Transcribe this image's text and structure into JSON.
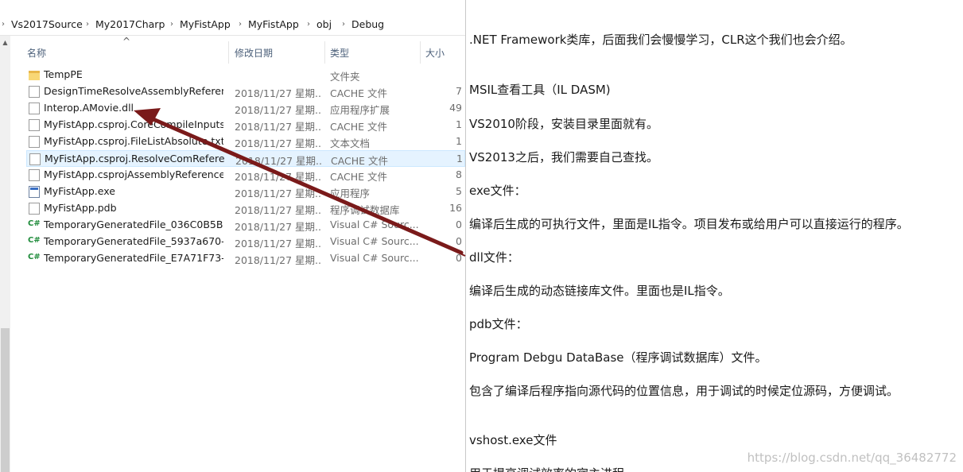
{
  "explorer": {
    "breadcrumb": [
      "Vs2017Source",
      "My2017Charp",
      "MyFistApp",
      "MyFistApp",
      "obj",
      "Debug"
    ],
    "columns": {
      "name": "名称",
      "date": "修改日期",
      "type": "类型",
      "size": "大小"
    },
    "files": [
      {
        "name": "TempPE",
        "date": "",
        "type": "文件夹",
        "size": "",
        "icon": "folder-icon",
        "selected": false
      },
      {
        "name": "DesignTimeResolveAssemblyReferen...",
        "date": "2018/11/27 星期...",
        "type": "CACHE 文件",
        "size": "7",
        "icon": "file-icon",
        "selected": false
      },
      {
        "name": "Interop.AMovie.dll",
        "date": "2018/11/27 星期...",
        "type": "应用程序扩展",
        "size": "49",
        "icon": "dll-file-icon",
        "selected": false
      },
      {
        "name": "MyFistApp.csproj.CoreCompileInputs...",
        "date": "2018/11/27 星期...",
        "type": "CACHE 文件",
        "size": "1",
        "icon": "file-icon",
        "selected": false
      },
      {
        "name": "MyFistApp.csproj.FileListAbsolute.txt",
        "date": "2018/11/27 星期...",
        "type": "文本文档",
        "size": "1",
        "icon": "text-file-icon",
        "selected": false
      },
      {
        "name": "MyFistApp.csproj.ResolveComRefere...",
        "date": "2018/11/27 星期...",
        "type": "CACHE 文件",
        "size": "1",
        "icon": "file-icon",
        "selected": true
      },
      {
        "name": "MyFistApp.csprojAssemblyReference....",
        "date": "2018/11/27 星期...",
        "type": "CACHE 文件",
        "size": "8",
        "icon": "file-icon",
        "selected": false
      },
      {
        "name": "MyFistApp.exe",
        "date": "2018/11/27 星期...",
        "type": "应用程序",
        "size": "5",
        "icon": "exe-file-icon",
        "selected": false
      },
      {
        "name": "MyFistApp.pdb",
        "date": "2018/11/27 星期...",
        "type": "程序调试数据库",
        "size": "16",
        "icon": "pdb-file-icon",
        "selected": false
      },
      {
        "name": "TemporaryGeneratedFile_036C0B5B-...",
        "date": "2018/11/27 星期...",
        "type": "Visual C# Sourc...",
        "size": "0",
        "icon": "csharp-file-icon",
        "selected": false
      },
      {
        "name": "TemporaryGeneratedFile_5937a670-0...",
        "date": "2018/11/27 星期...",
        "type": "Visual C# Sourc...",
        "size": "0",
        "icon": "csharp-file-icon",
        "selected": false
      },
      {
        "name": "TemporaryGeneratedFile_E7A71F73-0...",
        "date": "2018/11/27 星期...",
        "type": "Visual C# Sourc...",
        "size": "0",
        "icon": "csharp-file-icon",
        "selected": false
      }
    ],
    "cs_glyph": "C#"
  },
  "article": {
    "paragraphs": [
      ".NET Framework类库，后面我们会慢慢学习，CLR这个我们也会介绍。",
      "MSIL查看工具（IL DASM)",
      "VS2010阶段，安装目录里面就有。",
      "VS2013之后，我们需要自己查找。",
      "exe文件：",
      "编译后生成的可执行文件，里面是IL指令。项目发布或给用户可以直接运行的程序。",
      "dll文件：",
      "编译后生成的动态链接库文件。里面也是IL指令。",
      "pdb文件：",
      "Program Debgu DataBase（程序调试数据库）文件。",
      "包含了编译后程序指向源代码的位置信息，用于调试的时候定位源码，方便调试。",
      "vshost.exe文件",
      "用于提高调试效率的宿主进程"
    ],
    "watermark": "https://blog.csdn.net/qq_36482772"
  },
  "annotation": {
    "arrow_color": "#7a1a1a"
  }
}
